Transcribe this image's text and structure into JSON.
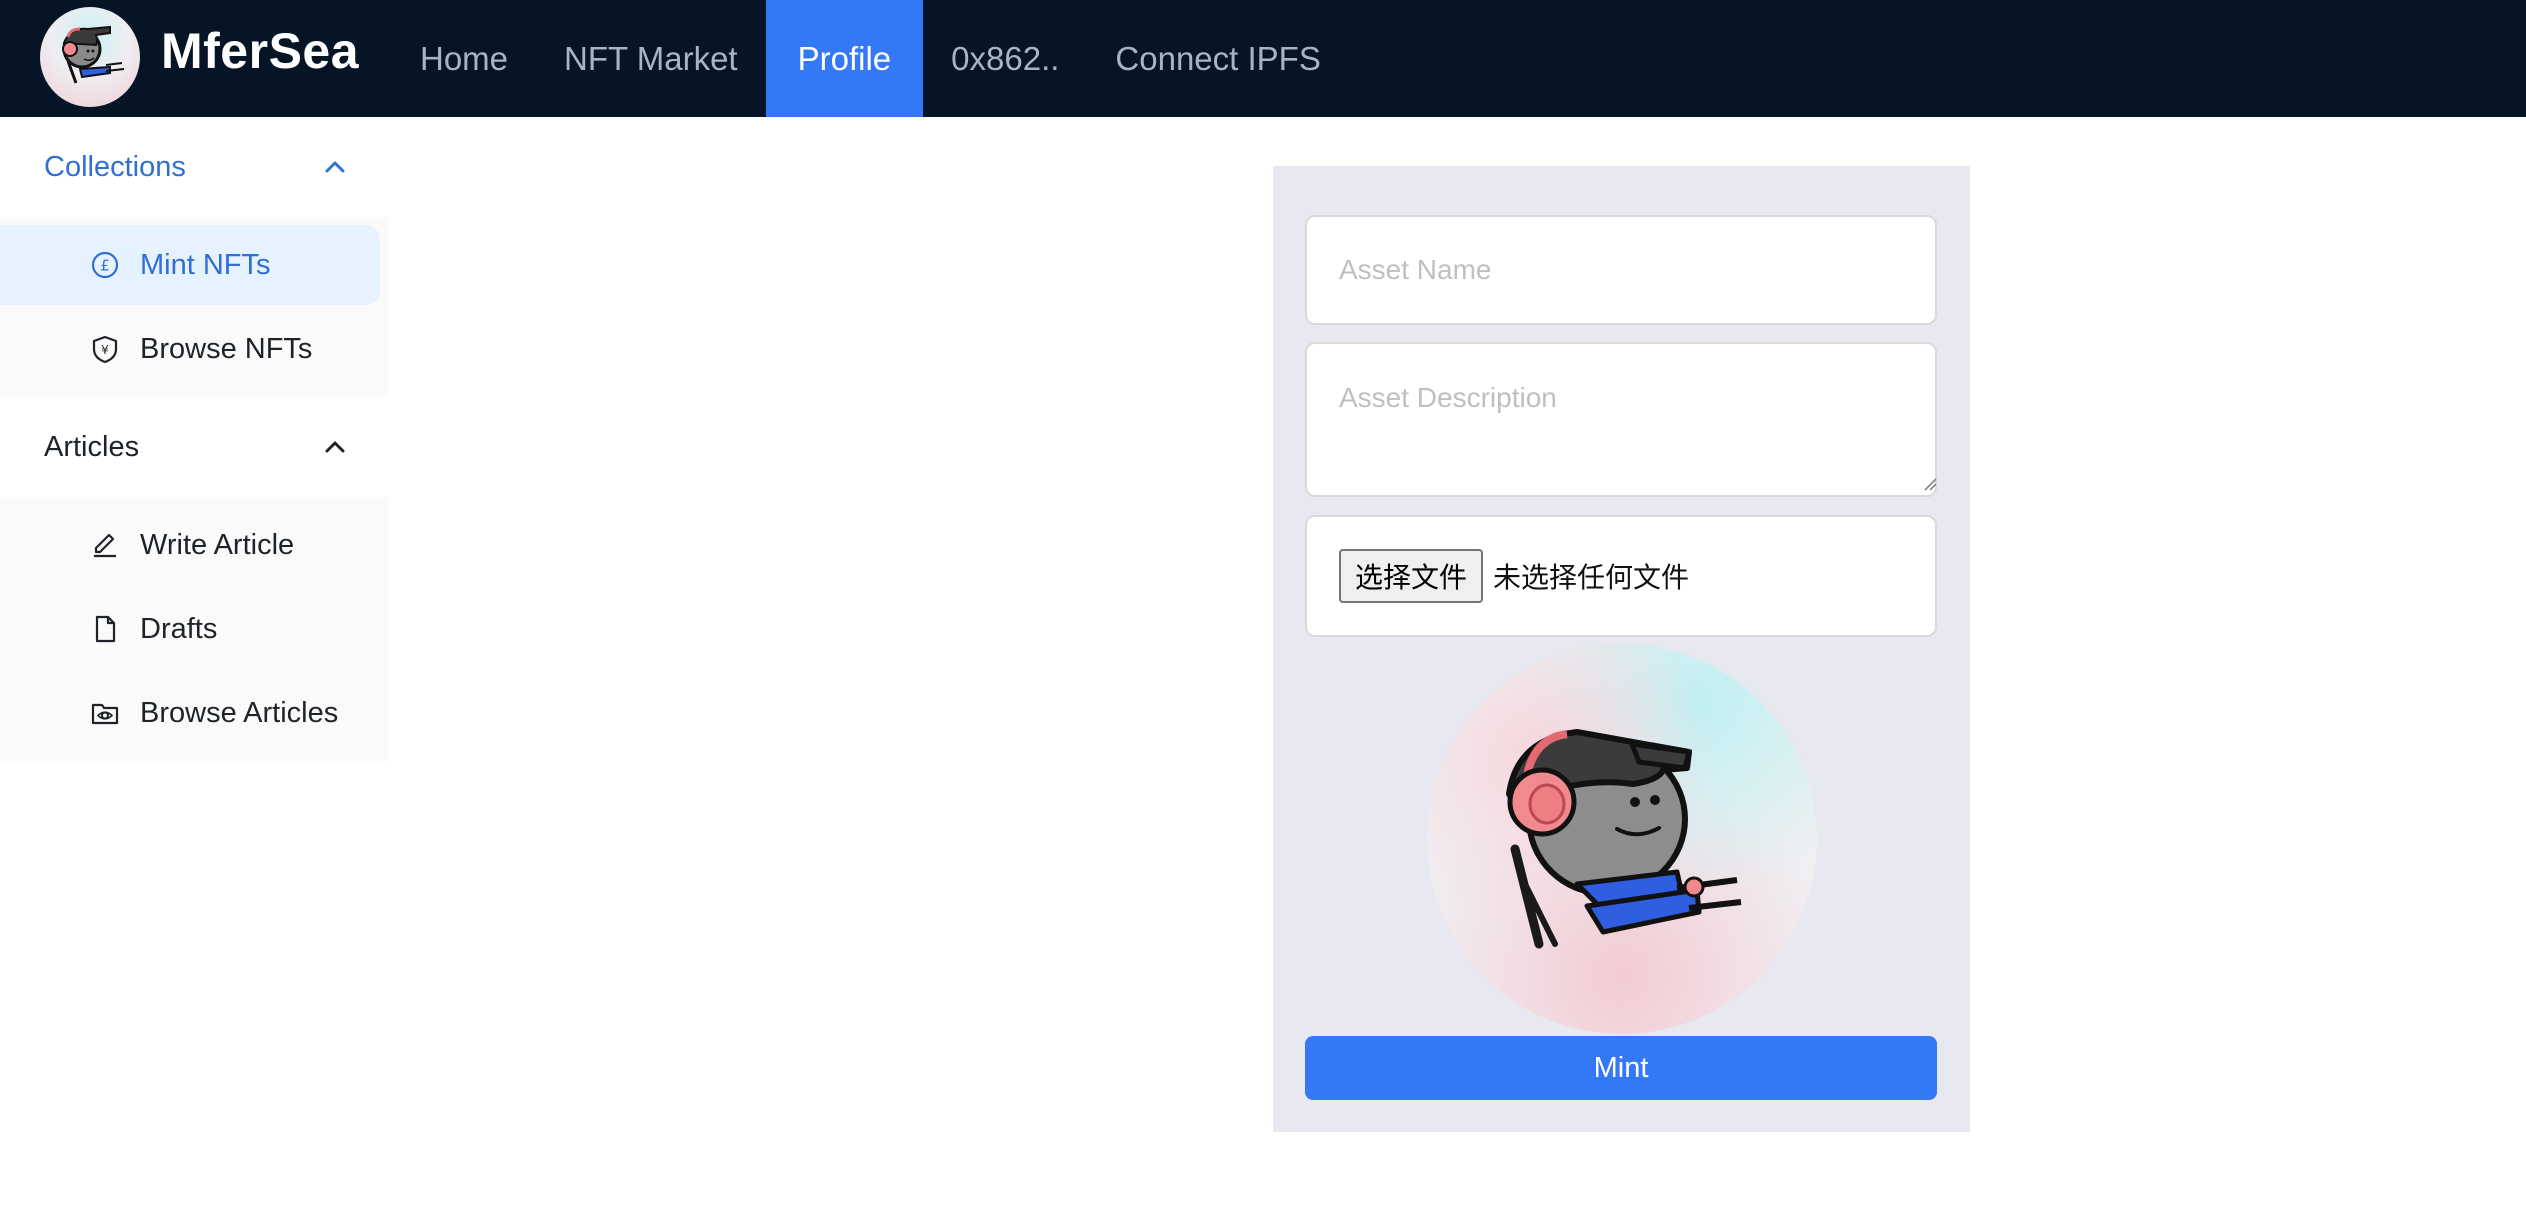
{
  "header": {
    "brand": "MferSea",
    "logo_icon": "mfer-avatar-icon",
    "nav": [
      {
        "label": "Home",
        "active": false
      },
      {
        "label": "NFT Market",
        "active": false
      },
      {
        "label": "Profile",
        "active": true
      },
      {
        "label": "0x862..",
        "active": false
      },
      {
        "label": "Connect IPFS",
        "active": false
      }
    ],
    "bg_color": "#061526",
    "accent_color": "#3478f6"
  },
  "sidebar": {
    "groups": [
      {
        "title": "Collections",
        "expanded": true,
        "items": [
          {
            "label": "Mint NFTs",
            "icon": "pound-circle-icon",
            "selected": true
          },
          {
            "label": "Browse NFTs",
            "icon": "yen-shield-icon",
            "selected": false
          }
        ]
      },
      {
        "title": "Articles",
        "expanded": true,
        "items": [
          {
            "label": "Write Article",
            "icon": "pencil-icon",
            "selected": false
          },
          {
            "label": "Drafts",
            "icon": "file-icon",
            "selected": false
          },
          {
            "label": "Browse Articles",
            "icon": "folder-view-icon",
            "selected": false
          }
        ]
      }
    ]
  },
  "form": {
    "asset_name_placeholder": "Asset Name",
    "asset_name_value": "",
    "asset_description_placeholder": "Asset Description",
    "asset_description_value": "",
    "file_button_label": "选择文件",
    "file_status": "未选择任何文件",
    "preview_icon": "mfer-nft-preview",
    "mint_label": "Mint"
  }
}
